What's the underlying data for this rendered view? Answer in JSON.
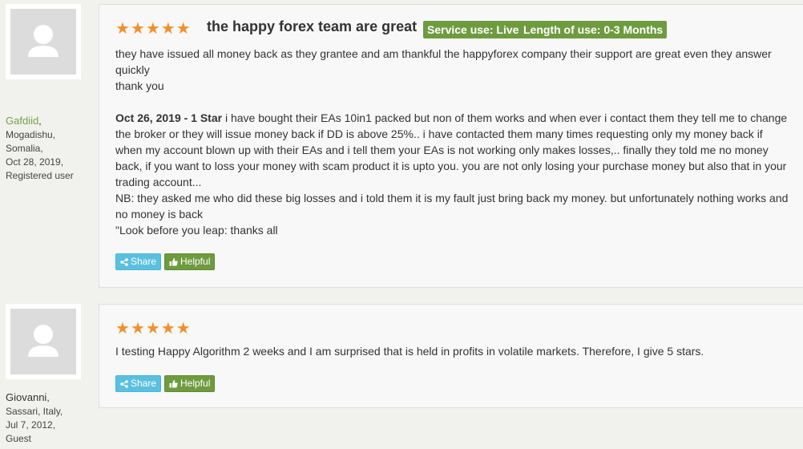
{
  "reviews": [
    {
      "author": {
        "name": "Gafdiid",
        "separator": ",",
        "city": "Mogadishu,",
        "country": "Somalia,",
        "date": "Oct 28, 2019,",
        "role": "Registered user"
      },
      "rating_stars": 5,
      "title": "the happy forex team are great",
      "badges": [
        "Service use: Live",
        "Length of use: 0-3 Months"
      ],
      "paragraph1": "they have issued all money back as they grantee and am thankful the happyforex company their support are great even they answer quickly",
      "paragraph2": "thank you",
      "update_label": "Oct 26, 2019 - 1 Star",
      "update_text": " i have bought their EAs 10in1 packed but non of them works and when ever i contact them they tell me to change the broker or they will issue money back if DD is above 25%.. i have contacted them many times requesting only my money back if when my account blown up with their EAs and i tell them your EAs is not working only makes losses,.. finally they told me no money back, if you want to loss your money with scam product it is upto you. you are not only losing your purchase money but also that in your trading account...",
      "nb_text": "NB: they asked me who did these big losses and i told them it is my fault just bring back my money. but unfortunately nothing works and no money is back",
      "quote_text": "\"Look before you leap: thanks all",
      "share_label": "Share",
      "helpful_label": "Helpful"
    },
    {
      "author": {
        "name": "Giovanni",
        "separator": ",",
        "city": "Sassari, Italy,",
        "date": "Jul 7, 2012,",
        "role": "Guest"
      },
      "rating_stars": 5,
      "text": "I testing Happy Algorithm 2 weeks and I am surprised that is held in profits in volatile markets. Therefore, I give 5 stars.",
      "share_label": "Share",
      "helpful_label": "Helpful"
    }
  ],
  "colors": {
    "star": "#f0902a",
    "badge": "#6f9b3f",
    "share": "#5bc0de",
    "helpful": "#6f9b3f",
    "author_link": "#73a246"
  },
  "icons": {
    "avatar": "user-silhouette-icon",
    "star": "star-icon",
    "share": "share-icon",
    "helpful": "thumbs-up-icon"
  }
}
